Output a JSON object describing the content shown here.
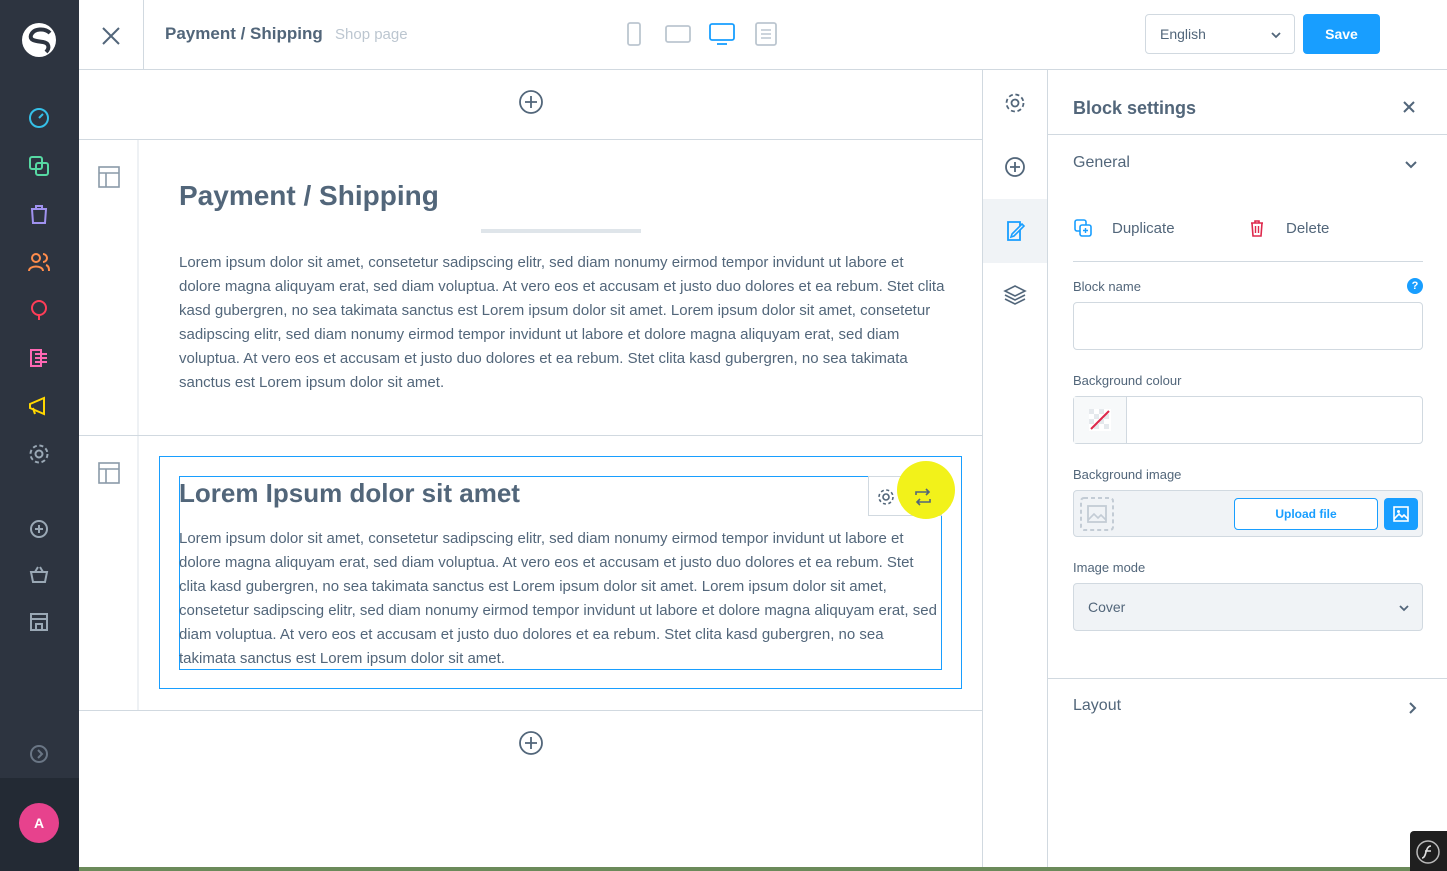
{
  "header": {
    "page_title": "Payment / Shipping",
    "page_subtitle": "Shop page",
    "language": "English",
    "save_label": "Save",
    "device_views": [
      "mobile-icon",
      "tablet-icon",
      "desktop-icon",
      "list-view-icon"
    ],
    "active_device": "desktop-icon"
  },
  "nav": {
    "icons": [
      "dashboard-icon",
      "catalogues-icon",
      "orders-icon",
      "customers-icon",
      "content-icon",
      "marketing-icon",
      "promotion-icon",
      "settings-icon",
      "add-icon",
      "basket-icon",
      "shop-icon",
      "expand-icon"
    ],
    "avatar_initial": "A"
  },
  "canvas": {
    "section1": {
      "heading": "Payment / Shipping",
      "text": "Lorem ipsum dolor sit amet, consetetur sadipscing elitr, sed diam nonumy eirmod tempor invidunt ut labore et dolore magna aliquyam erat, sed diam voluptua. At vero eos et accusam et justo duo dolores et ea rebum. Stet clita kasd gubergren, no sea takimata sanctus est Lorem ipsum dolor sit amet. Lorem ipsum dolor sit amet, consetetur sadipscing elitr, sed diam nonumy eirmod tempor invidunt ut labore et dolore magna aliquyam erat, sed diam voluptua. At vero eos et accusam et justo duo dolores et ea rebum. Stet clita kasd gubergren, no sea takimata sanctus est Lorem ipsum dolor sit amet."
    },
    "section2": {
      "heading": "Lorem Ipsum dolor sit amet",
      "text": "Lorem ipsum dolor sit amet, consetetur sadipscing elitr, sed diam nonumy eirmod tempor invidunt ut labore et dolore magna aliquyam erat, sed diam voluptua. At vero eos et accusam et justo duo dolores et ea rebum. Stet clita kasd gubergren, no sea takimata sanctus est Lorem ipsum dolor sit amet. Lorem ipsum dolor sit amet, consetetur sadipscing elitr, sed diam nonumy eirmod tempor invidunt ut labore et dolore magna aliquyam erat, sed diam voluptua. At vero eos et accusam et justo duo dolores et ea rebum. Stet clita kasd gubergren, no sea takimata sanctus est Lorem ipsum dolor sit amet."
    }
  },
  "side_tabs": [
    "settings-icon",
    "add-block-icon",
    "edit-block-icon",
    "layers-icon"
  ],
  "panel": {
    "title": "Block settings",
    "general_label": "General",
    "duplicate_label": "Duplicate",
    "delete_label": "Delete",
    "block_name_label": "Block name",
    "block_name_value": "",
    "bg_colour_label": "Background colour",
    "bg_image_label": "Background image",
    "upload_label": "Upload file",
    "image_mode_label": "Image mode",
    "image_mode_value": "Cover",
    "layout_label": "Layout",
    "help_glyph": "?"
  },
  "colors": {
    "accent": "#189eff",
    "nav_bg": "#2d3440",
    "highlight": "#f2f21a",
    "delete_red": "#de294c",
    "avatar": "#e7428d"
  }
}
